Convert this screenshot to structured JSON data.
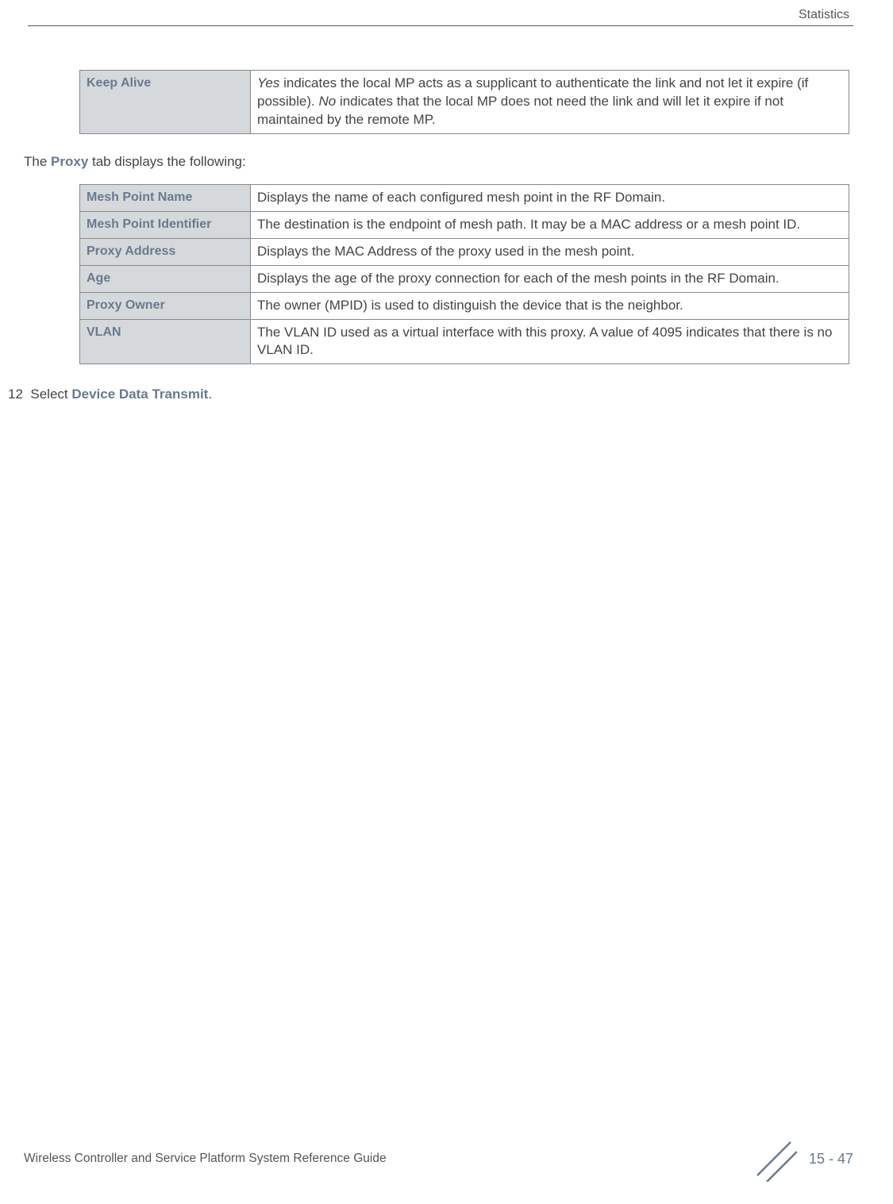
{
  "header": {
    "section": "Statistics"
  },
  "table1": {
    "rows": [
      {
        "label": "Keep Alive",
        "desc_prefix_italic": "Yes",
        "desc_part1": " indicates the local MP acts as a supplicant to authenticate the link and not let it expire (if possible). ",
        "desc_mid_italic": "No",
        "desc_part2": " indicates that the local MP does not need the link and will let it expire if not maintained by the remote MP."
      }
    ]
  },
  "intro": {
    "prefix": "The ",
    "bold": "Proxy",
    "suffix": " tab displays the following:"
  },
  "table2": {
    "rows": [
      {
        "label": "Mesh Point Name",
        "desc": "Displays the name of each configured mesh point in the RF Domain."
      },
      {
        "label": "Mesh Point Identifier",
        "desc": "The destination is the endpoint of mesh path. It may be a MAC address or a mesh point ID."
      },
      {
        "label": "Proxy Address",
        "desc": "Displays the MAC Address of the proxy used in the mesh point."
      },
      {
        "label": "Age",
        "desc": "Displays the age of the proxy connection for each of the mesh points in the RF Domain."
      },
      {
        "label": "Proxy Owner",
        "desc": "The owner (MPID) is used to distinguish the device that is the neighbor."
      },
      {
        "label": "VLAN",
        "desc": "The VLAN ID used as a virtual interface with this proxy. A value of 4095 indicates that there is no VLAN ID."
      }
    ]
  },
  "step": {
    "number": "12",
    "prefix": "Select ",
    "bold": "Device Data Transmit",
    "suffix": "."
  },
  "footer": {
    "left": "Wireless Controller and Service Platform System Reference Guide",
    "page": "15 - 47"
  }
}
